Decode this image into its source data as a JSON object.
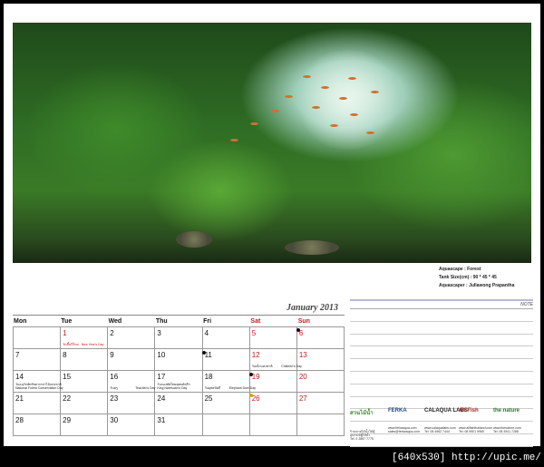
{
  "photo": {
    "description_icon": "aquascape-photo"
  },
  "info": {
    "aquascape": "Aquascape : Forest",
    "tank_size": "Tank Size(cm) : 90 * 45 * 45",
    "aquascaper": "Aquascaper : Jullawong Prapantha"
  },
  "calendar": {
    "month_title": "January 2013",
    "days": [
      "Mon",
      "Tue",
      "Wed",
      "Thu",
      "Fri",
      "Sat",
      "Sun"
    ],
    "weeks": [
      [
        {
          "n": ""
        },
        {
          "n": "1",
          "red": true,
          "hol": "วันขึ้นปีใหม่   New Year's Day"
        },
        {
          "n": "2"
        },
        {
          "n": "3"
        },
        {
          "n": "4"
        },
        {
          "n": "5",
          "red": true
        },
        {
          "n": "6",
          "red": true
        }
      ],
      [
        {
          "n": "7"
        },
        {
          "n": "8"
        },
        {
          "n": "9"
        },
        {
          "n": "10"
        },
        {
          "n": "11"
        },
        {
          "n": "12",
          "red": true,
          "hol": "วันเด็กแห่งชาติ          Children's Day",
          "blk": true
        },
        {
          "n": "13",
          "red": true
        }
      ],
      [
        {
          "n": "14",
          "hol": "วันอนุรักษ์ทรัพยากรป่าไม้แห่งชาติ\nNational Forest Conservation Day",
          "blk": true
        },
        {
          "n": "15"
        },
        {
          "n": "16",
          "hol": "วันครู                    Teacher's Day",
          "blk": true
        },
        {
          "n": "17",
          "hol": "วันกองทัพไทยยุทธหัตถีฯ\nKing Naresuan's Day",
          "blk": true
        },
        {
          "n": "18",
          "hol": "วันยุทธหัตถี          Elephant Duel Day",
          "blk": true
        },
        {
          "n": "19",
          "red": true
        },
        {
          "n": "20",
          "red": true
        }
      ],
      [
        {
          "n": "21"
        },
        {
          "n": "22"
        },
        {
          "n": "23"
        },
        {
          "n": "24"
        },
        {
          "n": "25"
        },
        {
          "n": "26",
          "red": true
        },
        {
          "n": "27",
          "red": true
        }
      ],
      [
        {
          "n": "28"
        },
        {
          "n": "29"
        },
        {
          "n": "30"
        },
        {
          "n": "31"
        },
        {
          "n": ""
        },
        {
          "n": ""
        },
        {
          "n": ""
        }
      ]
    ]
  },
  "notes": {
    "title": "NOTE"
  },
  "sponsors": [
    {
      "name": "สวนไม้น้ำ",
      "contact": "ร้านขายไม้น้ำไม้ตู้\nอุปกรณ์ตู้ไม้น้ำ\nTel. 0 2887 7775"
    },
    {
      "name": "FERKA",
      "contact": "www.ferkaaqua.com\nsales@ferkaaqua.com"
    },
    {
      "name": "CALAQUA LABS",
      "contact": "www.calaqualabs.com\nTel. 08 4962 7444"
    },
    {
      "name": "All Fish",
      "contact": "www.allfishthailand.com\nTel. 08 9901 9965"
    },
    {
      "name": "the nature",
      "contact": "www.thenature.com\nTel. 08 4941 7288"
    }
  ],
  "watermark": "[640x530] http://upic.me/"
}
